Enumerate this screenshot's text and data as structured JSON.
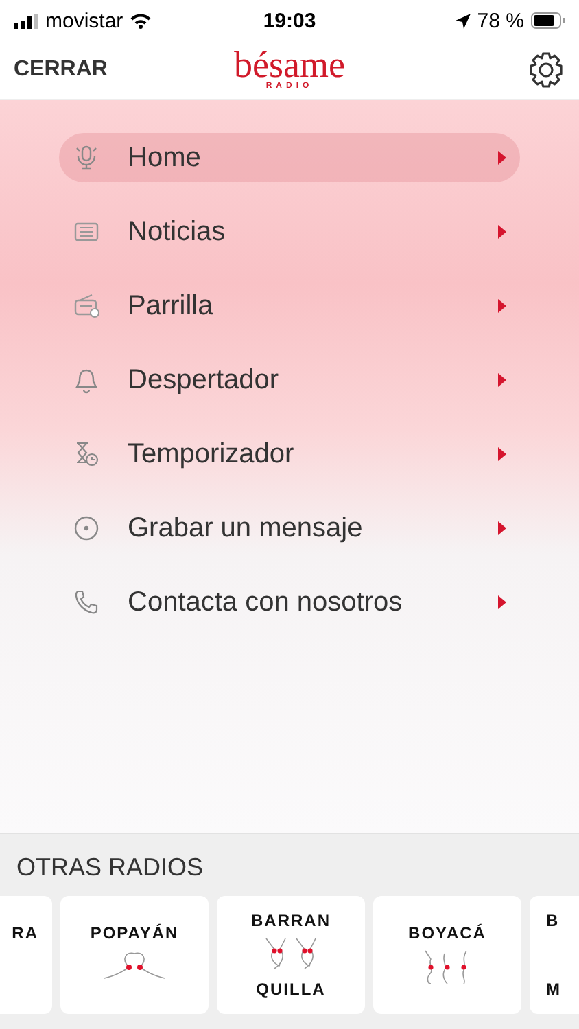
{
  "status_bar": {
    "carrier": "movistar",
    "time": "19:03",
    "battery": "78 %"
  },
  "header": {
    "close": "CERRAR",
    "logo": "bésame",
    "logo_sub": "RADIO"
  },
  "menu": [
    {
      "label": "Home",
      "selected": true
    },
    {
      "label": "Noticias",
      "selected": false
    },
    {
      "label": "Parrilla",
      "selected": false
    },
    {
      "label": "Despertador",
      "selected": false
    },
    {
      "label": "Temporizador",
      "selected": false
    },
    {
      "label": "Grabar un mensaje",
      "selected": false
    },
    {
      "label": "Contacta con nosotros",
      "selected": false
    }
  ],
  "other_radios": {
    "title": "OTRAS RADIOS",
    "stations": [
      {
        "kind": "cut-left",
        "lines": [
          "RA"
        ]
      },
      {
        "kind": "full",
        "lines": [
          "POPAYÁN"
        ]
      },
      {
        "kind": "full",
        "lines": [
          "BARRAN",
          "QUILLA"
        ]
      },
      {
        "kind": "full",
        "lines": [
          "BOYACÁ"
        ]
      },
      {
        "kind": "cut-right",
        "lines": [
          "B",
          "M"
        ]
      }
    ]
  }
}
